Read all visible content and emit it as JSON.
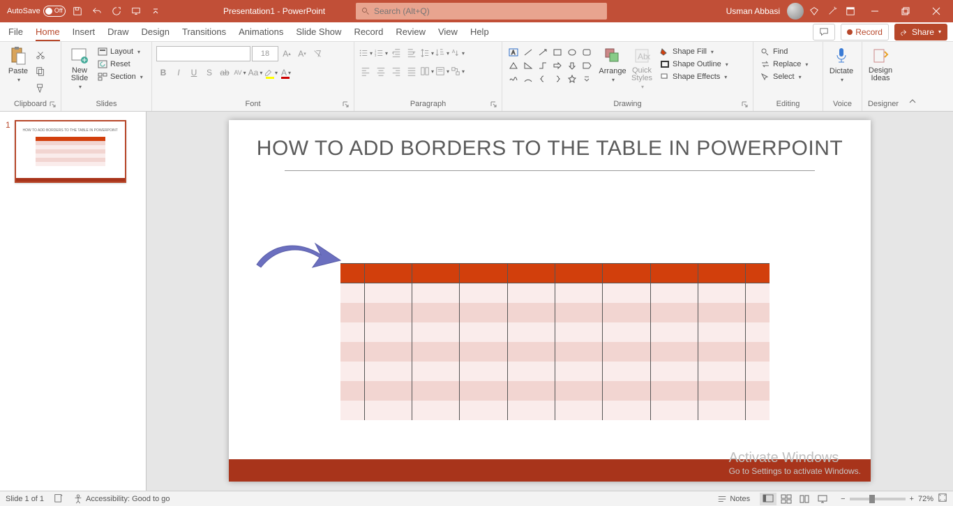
{
  "titlebar": {
    "autosave_label": "AutoSave",
    "autosave_state": "Off",
    "doc_title": "Presentation1 - PowerPoint",
    "search_placeholder": "Search (Alt+Q)",
    "user_name": "Usman Abbasi"
  },
  "tabs": {
    "file": "File",
    "home": "Home",
    "insert": "Insert",
    "draw": "Draw",
    "design": "Design",
    "transitions": "Transitions",
    "animations": "Animations",
    "slideshow": "Slide Show",
    "record": "Record",
    "review": "Review",
    "view": "View",
    "help": "Help",
    "record_btn": "Record",
    "share_btn": "Share"
  },
  "ribbon": {
    "clipboard": {
      "paste": "Paste",
      "label": "Clipboard"
    },
    "slides": {
      "new_slide": "New\nSlide",
      "layout": "Layout",
      "reset": "Reset",
      "section": "Section",
      "label": "Slides"
    },
    "font": {
      "name": "",
      "size": "18",
      "label": "Font"
    },
    "paragraph": {
      "label": "Paragraph"
    },
    "drawing": {
      "arrange": "Arrange",
      "quick_styles": "Quick\nStyles",
      "shape_fill": "Shape Fill",
      "shape_outline": "Shape Outline",
      "shape_effects": "Shape Effects",
      "label": "Drawing"
    },
    "editing": {
      "find": "Find",
      "replace": "Replace",
      "select": "Select",
      "label": "Editing"
    },
    "voice": {
      "dictate": "Dictate",
      "label": "Voice"
    },
    "designer": {
      "design_ideas": "Design\nIdeas",
      "label": "Designer"
    }
  },
  "thumbnails": {
    "num_1": "1",
    "title": "HOW TO ADD BORDERS TO THE TABLE IN POWERPOINT"
  },
  "slide": {
    "title": "HOW TO ADD BORDERS TO THE TABLE IN POWERPOINT",
    "watermark_l1": "Activate Windows",
    "watermark_l2": "Go to Settings to activate Windows.",
    "table_cols": 10,
    "table_body_rows": 7
  },
  "status": {
    "slide_info": "Slide 1 of 1",
    "accessibility": "Accessibility: Good to go",
    "notes": "Notes",
    "zoom": "72%"
  }
}
